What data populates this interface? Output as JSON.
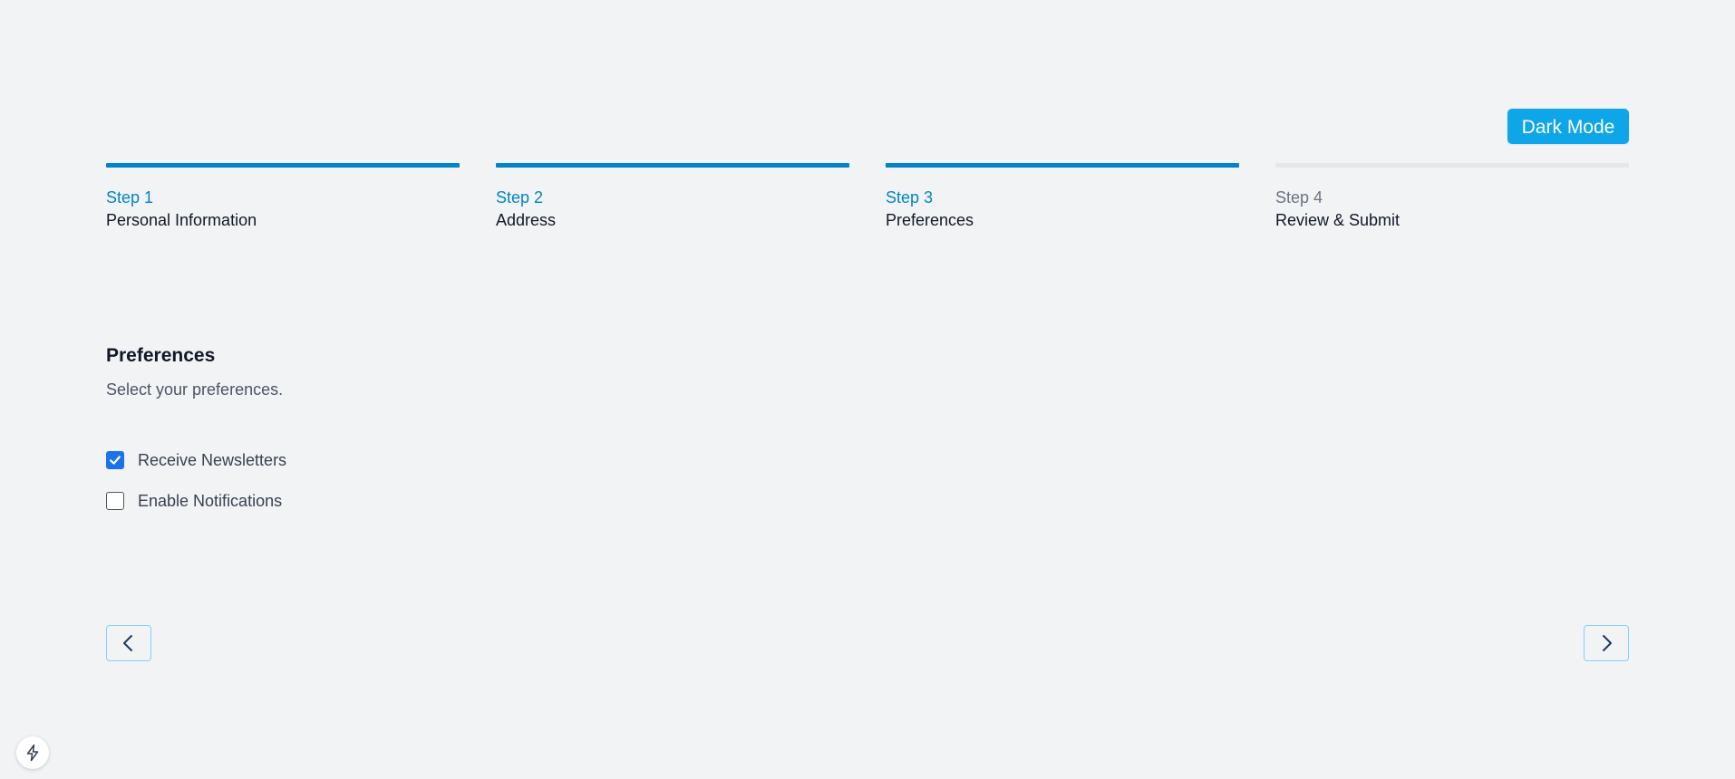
{
  "header": {
    "dark_mode_label": "Dark Mode"
  },
  "stepper": {
    "steps": [
      {
        "number": "Step 1",
        "title": "Personal Information",
        "complete": true
      },
      {
        "number": "Step 2",
        "title": "Address",
        "complete": true
      },
      {
        "number": "Step 3",
        "title": "Preferences",
        "complete": true
      },
      {
        "number": "Step 4",
        "title": "Review & Submit",
        "complete": false
      }
    ]
  },
  "panel": {
    "title": "Preferences",
    "subtitle": "Select your preferences.",
    "options": [
      {
        "label": "Receive Newsletters",
        "checked": true
      },
      {
        "label": "Enable Notifications",
        "checked": false
      }
    ]
  },
  "navigation": {
    "prev_icon": "chevron-left-icon",
    "next_icon": "chevron-right-icon"
  },
  "badge": {
    "icon": "lightning-bolt-icon"
  },
  "colors": {
    "accent": "#0284c7",
    "button": "#0ea5e9",
    "checkbox": "#1a73e8",
    "inactive_bar": "#e5e7eb",
    "background": "#f2f3f5"
  }
}
